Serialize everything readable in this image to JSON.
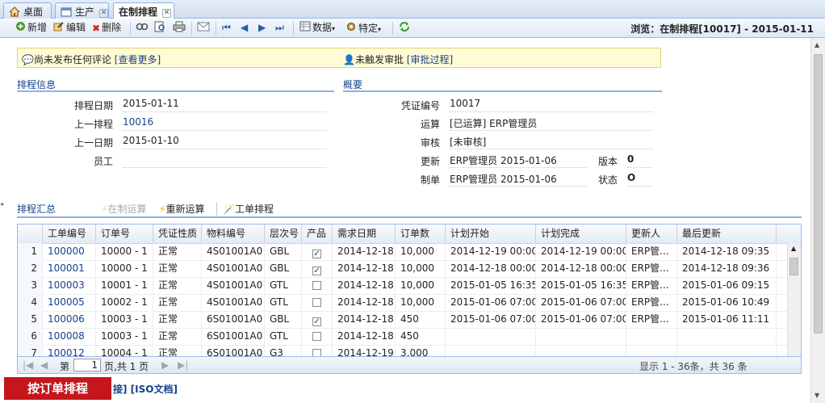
{
  "tabs": [
    {
      "label": "桌面",
      "icon": "home-icon"
    },
    {
      "label": "生产",
      "icon": "window-icon"
    },
    {
      "label": "在制排程",
      "icon": ""
    }
  ],
  "toolbar": {
    "new_label": "新增",
    "edit_label": "编辑",
    "delete_label": "删除",
    "data_label": "数据",
    "special_label": "特定",
    "browse_text": "浏览：在制排程[10017] - 2015-01-11"
  },
  "notice": {
    "comment_text": "尚未发布任何评论",
    "comment_link": "[查看更多]",
    "approval_text": "未触发审批",
    "approval_link": "[审批过程]"
  },
  "schedule_info": {
    "title": "排程信息",
    "fields": [
      {
        "label": "排程日期",
        "value": "2015-01-11"
      },
      {
        "label": "上一排程",
        "value": "10016"
      },
      {
        "label": "上一日期",
        "value": "2015-01-10"
      },
      {
        "label": "员工",
        "value": ""
      }
    ]
  },
  "overview": {
    "title": "概要",
    "voucher_label": "凭证编号",
    "voucher_value": "10017",
    "calc_label": "运算",
    "calc_value": "[已运算] ERP管理员",
    "audit_label": "审核",
    "audit_value": "[未审核]",
    "update_label": "更新",
    "update_value": "ERP管理员 2015-01-06",
    "version_label": "版本",
    "version_value": "0",
    "create_label": "制单",
    "create_value": "ERP管理员 2015-01-06",
    "status_label": "状态",
    "status_value": "O"
  },
  "summary": {
    "title": "排程汇总",
    "action_wip_calc": "在制运算",
    "action_recalc": "重新运算",
    "action_work_order_schedule": "工单排程"
  },
  "grid": {
    "columns": [
      "工单编号",
      "订单号",
      "凭证性质",
      "物料编号",
      "层次号",
      "产品",
      "需求日期",
      "订单数",
      "计划开始",
      "计划完成",
      "更新人",
      "最后更新"
    ],
    "rows": [
      {
        "n": "1",
        "wo": "100000",
        "order": "10000 - 1",
        "nature": "正常",
        "material": "4S01001A0",
        "level": "GBL",
        "product": true,
        "req": "2014-12-18",
        "qty": "10,000",
        "start": "2014-12-19 00:00",
        "finish": "2014-12-19 00:00",
        "updater": "ERP管...",
        "updated": "2014-12-18 09:35"
      },
      {
        "n": "2",
        "wo": "100001",
        "order": "10000 - 1",
        "nature": "正常",
        "material": "4S01001A0",
        "level": "GBL",
        "product": true,
        "req": "2014-12-18",
        "qty": "10,000",
        "start": "2014-12-18 00:00",
        "finish": "2014-12-18 00:00",
        "updater": "ERP管...",
        "updated": "2014-12-18 09:36"
      },
      {
        "n": "3",
        "wo": "100003",
        "order": "10001 - 1",
        "nature": "正常",
        "material": "4S01001A0",
        "level": "GTL",
        "product": false,
        "req": "2014-12-18",
        "qty": "10,000",
        "start": "2015-01-05 16:35",
        "finish": "2015-01-05 16:35",
        "updater": "ERP管...",
        "updated": "2015-01-06 09:15"
      },
      {
        "n": "4",
        "wo": "100005",
        "order": "10002 - 1",
        "nature": "正常",
        "material": "4S01001A0",
        "level": "GTL",
        "product": false,
        "req": "2014-12-18",
        "qty": "10,000",
        "start": "2015-01-06 07:00",
        "finish": "2015-01-06 07:00",
        "updater": "ERP管...",
        "updated": "2015-01-06 10:49"
      },
      {
        "n": "5",
        "wo": "100006",
        "order": "10003 - 1",
        "nature": "正常",
        "material": "6S01001A0",
        "level": "GBL",
        "product": true,
        "req": "2014-12-18",
        "qty": "450",
        "start": "2015-01-06 07:00",
        "finish": "2015-01-06 07:00",
        "updater": "ERP管...",
        "updated": "2015-01-06 11:11"
      },
      {
        "n": "6",
        "wo": "100008",
        "order": "10003 - 1",
        "nature": "正常",
        "material": "6S01001A0",
        "level": "GTL",
        "product": false,
        "req": "2014-12-18",
        "qty": "450",
        "start": "",
        "finish": "",
        "updater": "",
        "updated": ""
      },
      {
        "n": "7",
        "wo": "100012",
        "order": "10004 - 1",
        "nature": "正常",
        "material": "6S01001A0",
        "level": "G3",
        "product": false,
        "req": "2014-12-19",
        "qty": "3,000",
        "start": "",
        "finish": "",
        "updater": "",
        "updated": ""
      }
    ]
  },
  "pager": {
    "page_prefix": "第",
    "page_value": "1",
    "page_suffix": "页,共 1 页",
    "display_text": "显示 1 - 36条，共 36 条"
  },
  "bottom": {
    "red_button": "按订单排程",
    "links": "接] [ISO文档]"
  }
}
